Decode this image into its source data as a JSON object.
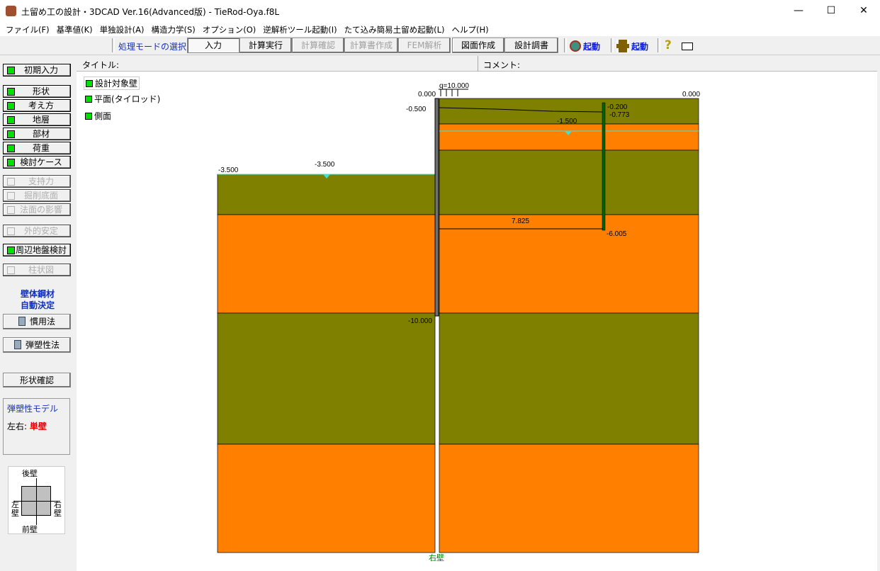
{
  "window": {
    "title": "土留め工の設計・3DCAD Ver.16(Advanced版) - TieRod-Oya.f8L",
    "minimize": "—",
    "maximize": "☐",
    "close": "✕"
  },
  "menu": [
    "ファイル(F)",
    "基準値(K)",
    "単独設計(A)",
    "構造力学(S)",
    "オプション(O)",
    "逆解析ツール起動(I)",
    "たて込み簡易土留め起動(L)",
    "ヘルプ(H)"
  ],
  "toolbar": {
    "mode_label": "処理モードの選択",
    "buttons": [
      "入力",
      "計算実行",
      "計算確認",
      "計算書作成",
      "FEM解析",
      "図面作成",
      "設計調書"
    ],
    "launch1": "起動",
    "launch2": "起動",
    "help": "?"
  },
  "header": {
    "title_label": "タイトル:",
    "comment_label": "コメント:"
  },
  "sidebar": {
    "initial": "初期入力",
    "items": [
      "形状",
      "考え方",
      "地層",
      "部材",
      "荷重",
      "検討ケース"
    ],
    "disabled": [
      "支持力",
      "掘削底面",
      "法面の影響"
    ],
    "external": "外的安定",
    "surround": "周辺地盤検討",
    "column": "柱状図",
    "auto_title1": "壁体鋼材",
    "auto_title2": "自動決定",
    "calc1": "慣用法",
    "calc2": "弾塑性法",
    "shape_check": "形状確認",
    "model_title": "弾塑性モデル",
    "lr_label": "左右:",
    "lr_value": "単壁",
    "walls": {
      "back": "後壁",
      "front": "前壁",
      "left": "左壁",
      "right": "右壁"
    }
  },
  "views": [
    "設計対象壁",
    "平面(タイロッド)",
    "側面"
  ],
  "drawing": {
    "load": "q=10.000",
    "left_top": "0.000",
    "right_top": "0.000",
    "rod_level": "-0.500",
    "anchor_top": "-0.200",
    "anchor_rod": "-0.773",
    "water_right": "-1.500",
    "left_ground": "-3.500",
    "water_left": "-3.500",
    "rod_length": "7.825",
    "anchor_bottom": "-6.005",
    "wall_bottom": "-10.000",
    "wall_name": "右壁"
  },
  "colors": {
    "olive": "#808000",
    "orange": "#ff8000",
    "water": "#40e0d0",
    "anchor": "#006400"
  }
}
